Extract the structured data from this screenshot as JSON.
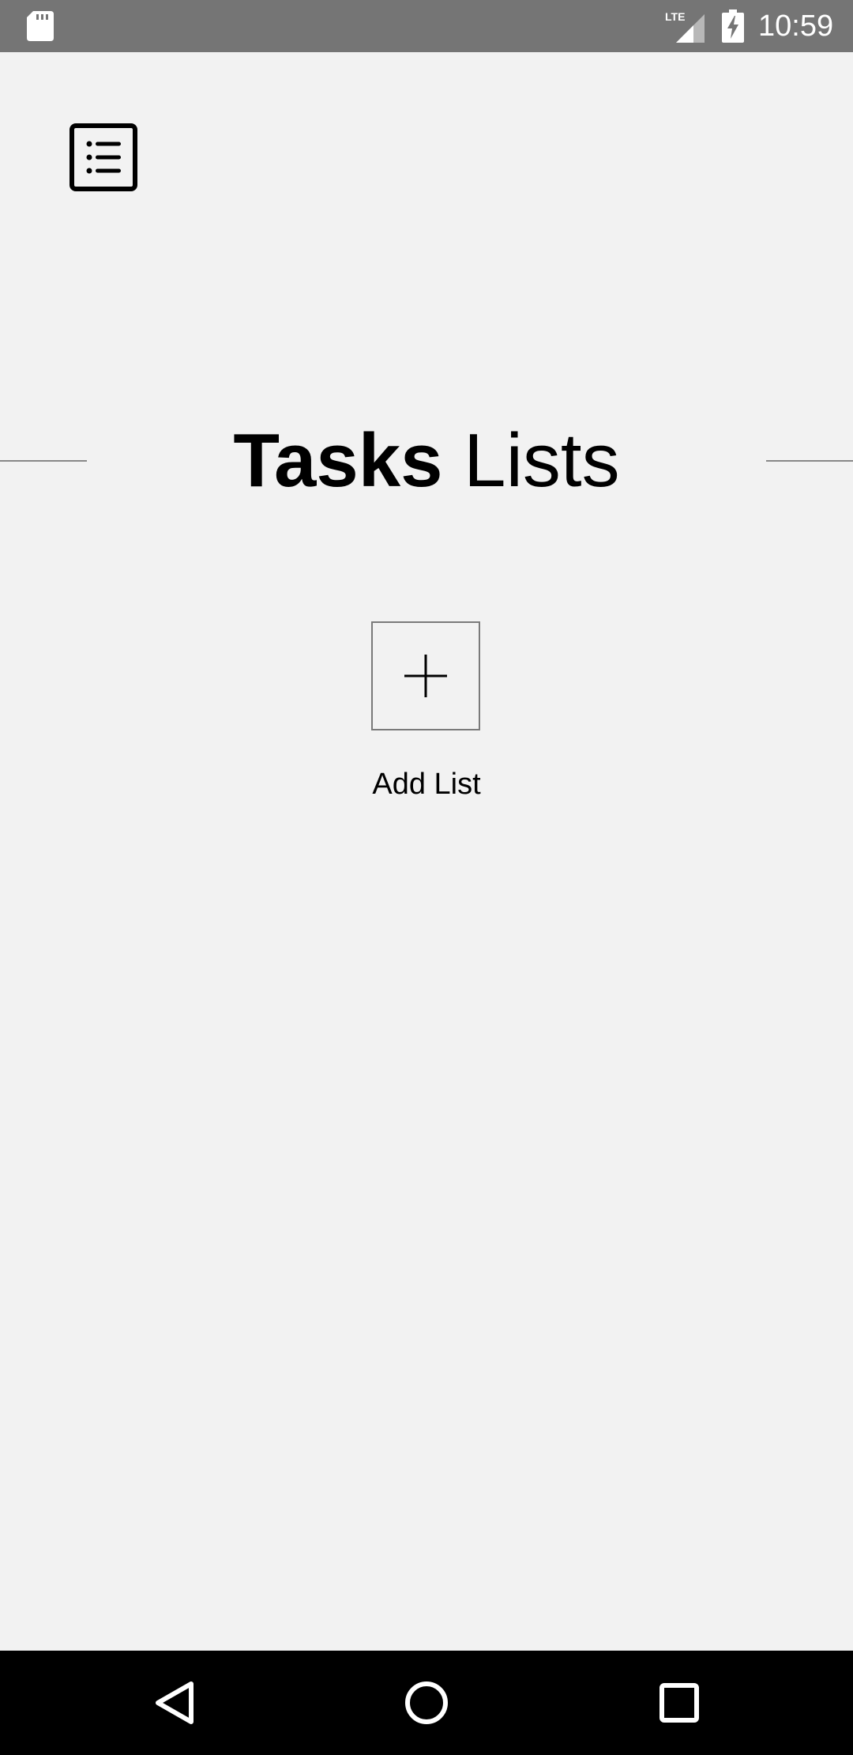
{
  "status_bar": {
    "time": "10:59",
    "network": "LTE",
    "icons": [
      "sd-card-icon",
      "lte-signal-icon",
      "battery-charging-icon"
    ]
  },
  "header": {
    "menu_icon": "list-icon"
  },
  "title": {
    "bold": "Tasks",
    "regular": "Lists"
  },
  "add_list": {
    "icon": "plus-icon",
    "label": "Add List"
  },
  "nav_bar": {
    "buttons": [
      "back-icon",
      "home-icon",
      "recents-icon"
    ]
  },
  "colors": {
    "background": "#f2f2f2",
    "status_bar": "#757575",
    "nav_bar": "#000000",
    "text": "#000000",
    "divider": "#888888"
  }
}
